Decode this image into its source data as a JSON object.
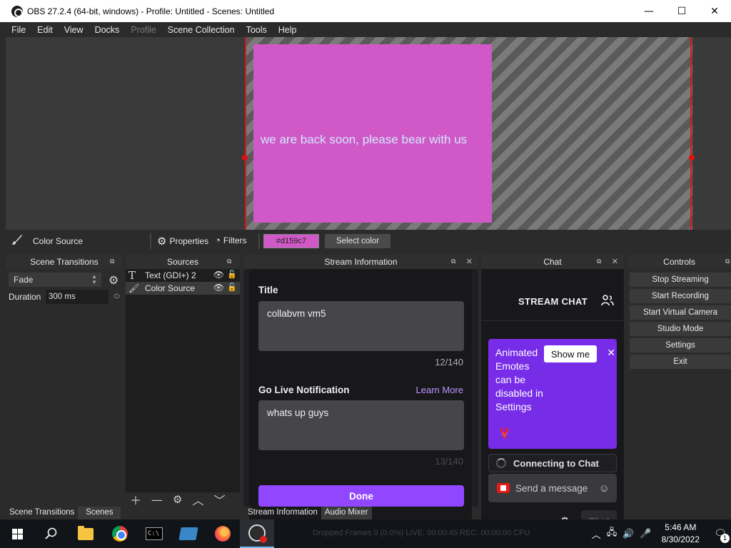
{
  "window": {
    "title": "OBS 27.2.4 (64-bit, windows) - Profile: Untitled - Scenes: Untitled",
    "minimize": "—",
    "maximize": "☐",
    "close": "✕"
  },
  "menu": [
    "File",
    "Edit",
    "View",
    "Docks",
    "Profile",
    "Scene Collection",
    "Tools",
    "Help"
  ],
  "menu_disabled_index": 4,
  "preview": {
    "text": "we are back soon, please bear with us",
    "color": "#d159c7"
  },
  "source_toolbar": {
    "source_name": "Color Source",
    "properties": "Properties",
    "filters": "Filters",
    "color_value": "#d159c7",
    "select_color": "Select color"
  },
  "scene_transitions": {
    "header": "Scene Transitions",
    "transition": "Fade",
    "duration_label": "Duration",
    "duration_value": "300 ms"
  },
  "sources": {
    "header": "Sources",
    "items": [
      {
        "label": "Text (GDI+) 2",
        "icon": "text-icon"
      },
      {
        "label": "Color Source",
        "icon": "brush-icon"
      }
    ]
  },
  "stream_info": {
    "header": "Stream Information",
    "title_label": "Title",
    "title_value": "collabvm vm5",
    "title_count": "12/140",
    "notif_label": "Go Live Notification",
    "learn_more": "Learn More",
    "notif_value": "whats up guys",
    "notif_count": "13/140",
    "done": "Done"
  },
  "chat": {
    "header": "Chat",
    "title": "STREAM CHAT",
    "banner_text": "Animated Emotes can be disabled in Settings",
    "show_me": "Show me",
    "connecting": "Connecting to Chat",
    "send_placeholder": "Send a message",
    "chat_button": "Chat"
  },
  "controls": {
    "header": "Controls",
    "buttons": [
      "Stop Streaming",
      "Start Recording",
      "Start Virtual Camera",
      "Studio Mode",
      "Settings",
      "Exit"
    ]
  },
  "tabs_left": [
    "Scene Transitions",
    "Scenes"
  ],
  "tabs_mid": [
    "Stream Information",
    "Audio Mixer"
  ],
  "status_bar": "Dropped Frames 0 (0.0%)   LIVE: 00:00:45   REC: 00:00:00   CPU",
  "taskbar": {
    "time": "5:46 AM",
    "date": "8/30/2022",
    "notifications": "1"
  }
}
